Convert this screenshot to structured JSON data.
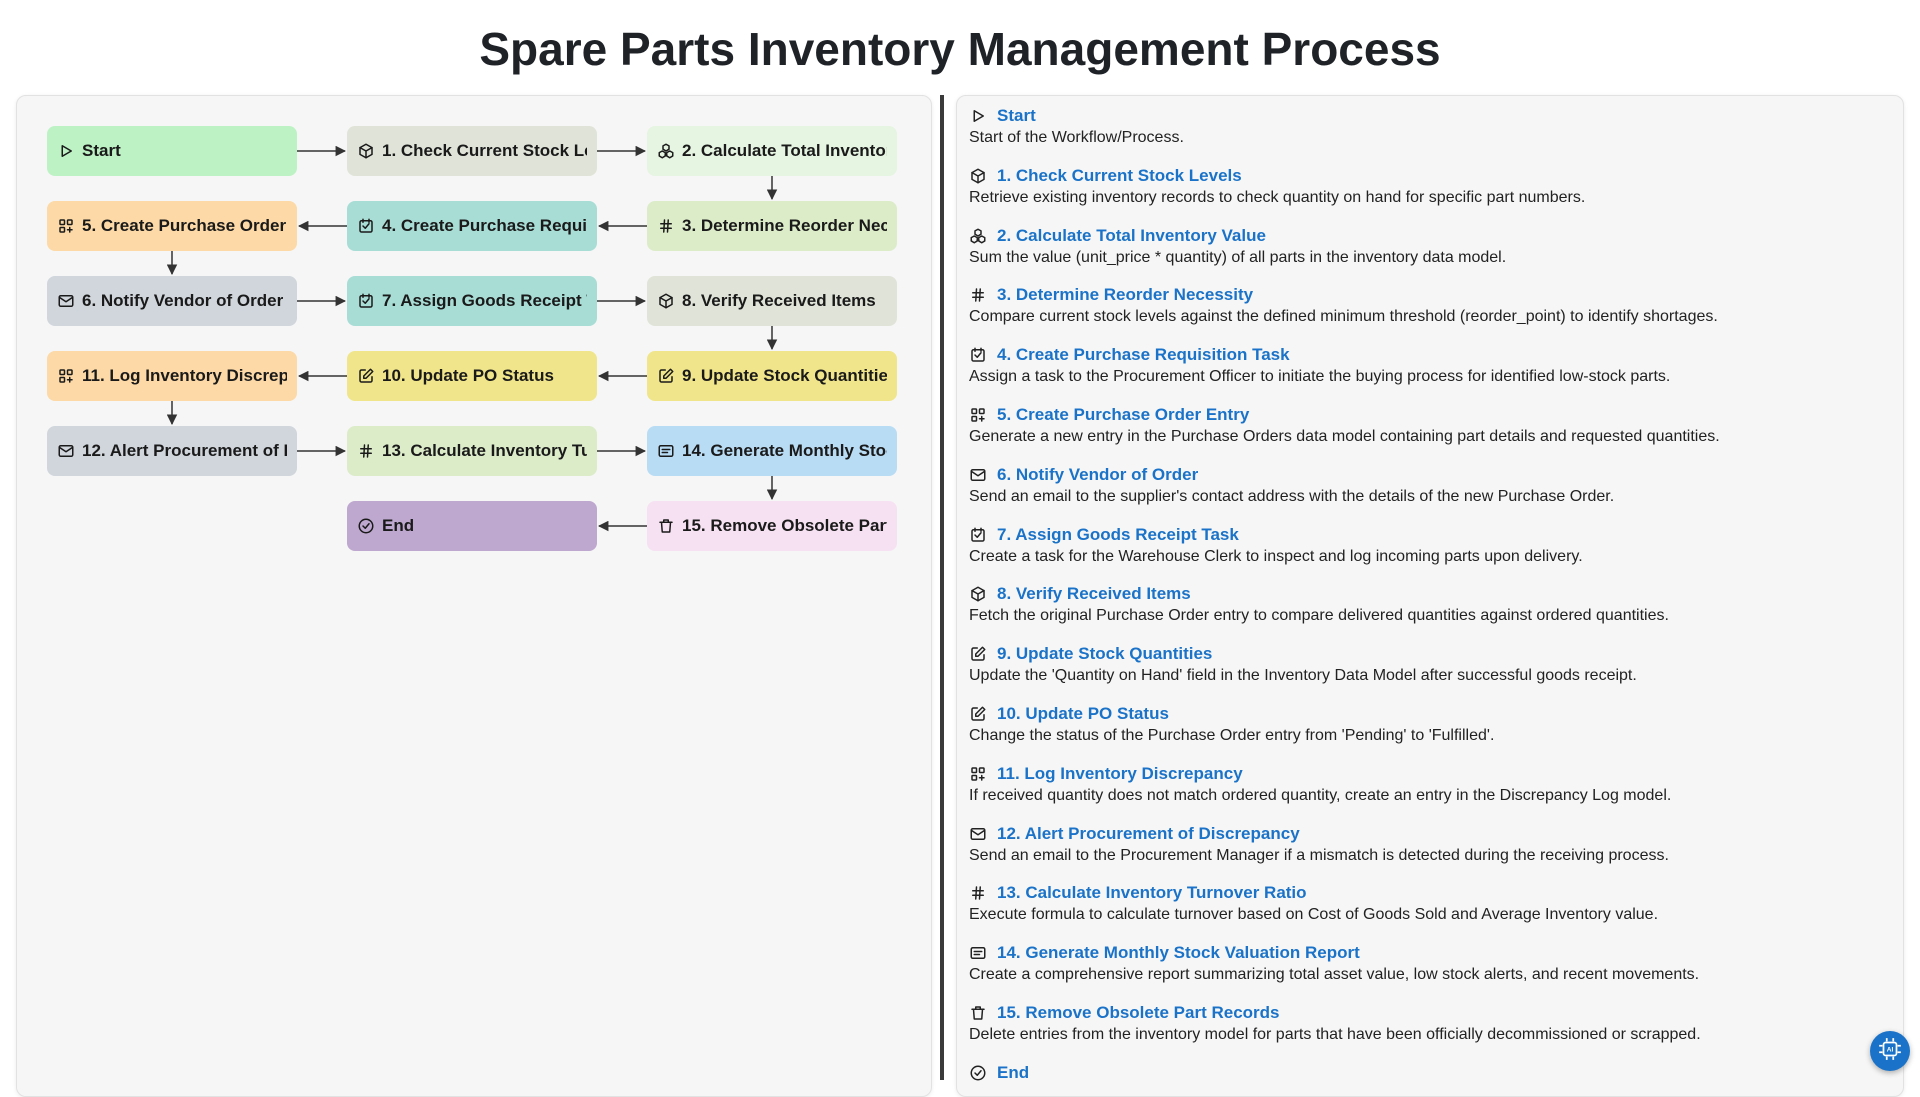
{
  "title": "Spare Parts Inventory Management Process",
  "colors": {
    "start": "#bdf2c4",
    "end": "#bea8cf",
    "link": "#1a73c8"
  },
  "nodes": [
    {
      "label": "Start",
      "icon": "play-icon",
      "color": "#bdf2c4"
    },
    {
      "label": "1. Check Current Stock Levels",
      "icon": "cube-icon",
      "color": "#dfe3d8"
    },
    {
      "label": "2. Calculate Total Inventory Value",
      "icon": "cubes-icon",
      "color": "#e6f5e2"
    },
    {
      "label": "3. Determine Reorder Necessity",
      "icon": "hash-icon",
      "color": "#dcecc9"
    },
    {
      "label": "4. Create Purchase Requisition Task",
      "icon": "checkbox-icon",
      "color": "#a8ddd6"
    },
    {
      "label": "5. Create Purchase Order Entry",
      "icon": "grid-icon",
      "color": "#fcd9a6"
    },
    {
      "label": "6. Notify Vendor of Order",
      "icon": "mail-icon",
      "color": "#d0d6dc"
    },
    {
      "label": "7. Assign Goods Receipt Task",
      "icon": "checkbox-icon",
      "color": "#a8ddd6"
    },
    {
      "label": "8. Verify Received Items",
      "icon": "cube-icon",
      "color": "#dfe3d8"
    },
    {
      "label": "9. Update Stock Quantities",
      "icon": "edit-icon",
      "color": "#f0e58a"
    },
    {
      "label": "10. Update PO Status",
      "icon": "edit-icon",
      "color": "#f0e58a"
    },
    {
      "label": "11. Log Inventory Discrepancy",
      "icon": "grid-icon",
      "color": "#fcd9a6"
    },
    {
      "label": "12. Alert Procurement of Discrepancy",
      "icon": "mail-icon",
      "color": "#d0d6dc"
    },
    {
      "label": "13. Calculate Inventory Turnover Ratio",
      "icon": "hash-icon",
      "color": "#dcecc9"
    },
    {
      "label": "14. Generate Monthly Stock Valuation Report",
      "icon": "list-icon",
      "color": "#b9dcf5"
    },
    {
      "label": "15. Remove Obsolete Part Records",
      "icon": "trash-icon",
      "color": "#f6e1f2"
    },
    {
      "label": "End",
      "icon": "check-circle-icon",
      "color": "#bea8cf"
    }
  ],
  "steps": [
    {
      "title": "Start",
      "icon": "play-icon",
      "desc": "Start of the Workflow/Process."
    },
    {
      "title": "1. Check Current Stock Levels",
      "icon": "cube-icon",
      "desc": "Retrieve existing inventory records to check quantity on hand for specific part numbers."
    },
    {
      "title": "2. Calculate Total Inventory Value",
      "icon": "cubes-icon",
      "desc": "Sum the value (unit_price * quantity) of all parts in the inventory data model."
    },
    {
      "title": "3. Determine Reorder Necessity",
      "icon": "hash-icon",
      "desc": "Compare current stock levels against the defined minimum threshold (reorder_point) to identify shortages."
    },
    {
      "title": "4. Create Purchase Requisition Task",
      "icon": "checkbox-icon",
      "desc": "Assign a task to the Procurement Officer to initiate the buying process for identified low-stock parts."
    },
    {
      "title": "5. Create Purchase Order Entry",
      "icon": "grid-icon",
      "desc": "Generate a new entry in the Purchase Orders data model containing part details and requested quantities."
    },
    {
      "title": "6. Notify Vendor of Order",
      "icon": "mail-icon",
      "desc": "Send an email to the supplier's contact address with the details of the new Purchase Order."
    },
    {
      "title": "7. Assign Goods Receipt Task",
      "icon": "checkbox-icon",
      "desc": "Create a task for the Warehouse Clerk to inspect and log incoming parts upon delivery."
    },
    {
      "title": "8. Verify Received Items",
      "icon": "cube-icon",
      "desc": "Fetch the original Purchase Order entry to compare delivered quantities against ordered quantities."
    },
    {
      "title": "9. Update Stock Quantities",
      "icon": "edit-icon",
      "desc": "Update the 'Quantity on Hand' field in the Inventory Data Model after successful goods receipt."
    },
    {
      "title": "10. Update PO Status",
      "icon": "edit-icon",
      "desc": "Change the status of the Purchase Order entry from 'Pending' to 'Fulfilled'."
    },
    {
      "title": "11. Log Inventory Discrepancy",
      "icon": "grid-icon",
      "desc": "If received quantity does not match ordered quantity, create an entry in the Discrepancy Log model."
    },
    {
      "title": "12. Alert Procurement of Discrepancy",
      "icon": "mail-icon",
      "desc": "Send an email to the Procurement Manager if a mismatch is detected during the receiving process."
    },
    {
      "title": "13. Calculate Inventory Turnover Ratio",
      "icon": "hash-icon",
      "desc": "Execute formula to calculate turnover based on Cost of Goods Sold and Average Inventory value."
    },
    {
      "title": "14. Generate Monthly Stock Valuation Report",
      "icon": "list-icon",
      "desc": "Create a comprehensive report summarizing total asset value, low stock alerts, and recent movements."
    },
    {
      "title": "15. Remove Obsolete Part Records",
      "icon": "trash-icon",
      "desc": "Delete entries from the inventory model for parts that have been officially decommissioned or scrapped."
    },
    {
      "title": "End",
      "icon": "check-circle-icon",
      "desc": ""
    }
  ],
  "fab": {
    "icon": "ai-chip-icon"
  }
}
